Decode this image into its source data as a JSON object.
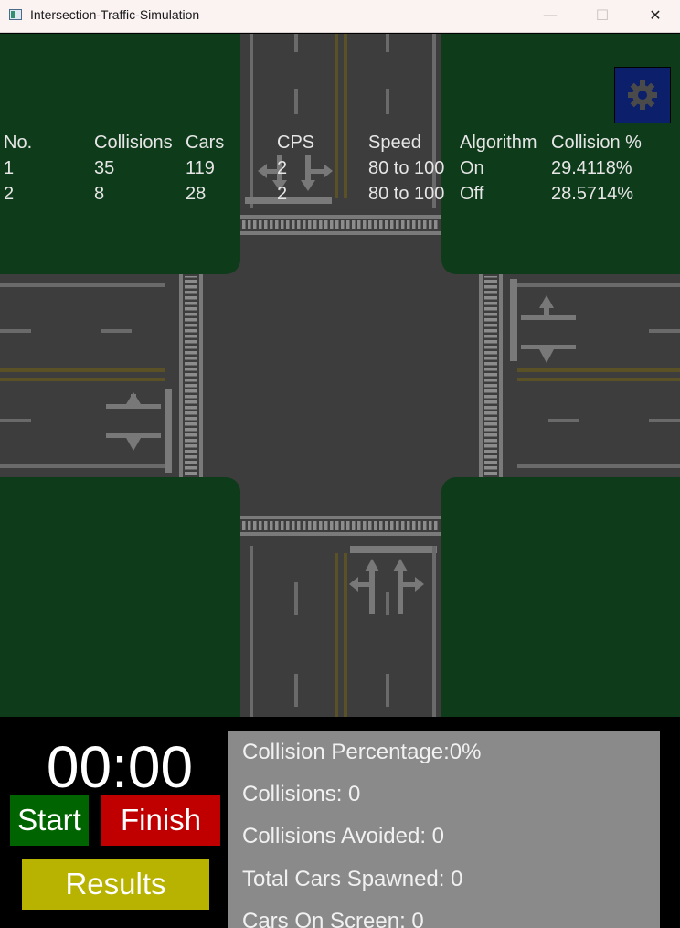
{
  "window": {
    "title": "Intersection-Traffic-Simulation",
    "minimize_glyph": "—",
    "maximize_glyph": "☐",
    "close_glyph": "✕"
  },
  "colors": {
    "grass": "#0e3b1a",
    "road": "#3d3d3d",
    "lane_line": "#8a8a8a",
    "center_line": "#5a5226",
    "settings_button": "#0b1f6a",
    "start": "#006400",
    "finish": "#c00000",
    "results": "#b8b200",
    "panel": "#8a8a8a"
  },
  "settings_icon": "gear-icon",
  "stats_table": {
    "headers": [
      "No.",
      "Collisions",
      "Cars",
      "CPS",
      "Speed",
      "Algorithm",
      "Collision %"
    ],
    "rows": [
      [
        "1",
        "35",
        "119",
        "2",
        "80 to 100",
        "On",
        "29.4118%"
      ],
      [
        "2",
        "8",
        "28",
        "2",
        "80 to 100",
        "Off",
        "28.5714%"
      ]
    ]
  },
  "timer": "00:00",
  "buttons": {
    "start": "Start",
    "finish": "Finish",
    "results": "Results"
  },
  "live_stats": [
    "Collision Percentage:0%",
    "Collisions: 0",
    "Collisions Avoided: 0",
    "Total Cars Spawned: 0",
    "Cars On Screen: 0"
  ]
}
